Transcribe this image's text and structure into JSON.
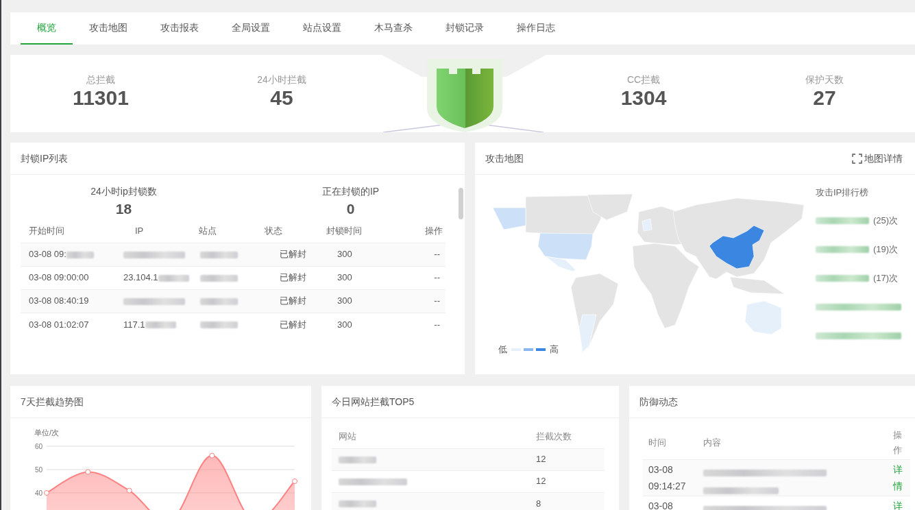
{
  "tabs": [
    {
      "label": "概览",
      "selected": true
    },
    {
      "label": "攻击地图",
      "selected": false
    },
    {
      "label": "攻击报表",
      "selected": false
    },
    {
      "label": "全局设置",
      "selected": false
    },
    {
      "label": "站点设置",
      "selected": false
    },
    {
      "label": "木马查杀",
      "selected": false
    },
    {
      "label": "封锁记录",
      "selected": false
    },
    {
      "label": "操作日志",
      "selected": false
    }
  ],
  "stats": [
    {
      "label": "总拦截",
      "value": "11301"
    },
    {
      "label": "24小时拦截",
      "value": "45"
    },
    {
      "label": "CC拦截",
      "value": "1304"
    },
    {
      "label": "保护天数",
      "value": "27"
    }
  ],
  "block_list": {
    "title": "封锁IP列表",
    "summary": [
      {
        "label": "24小时ip封锁数",
        "value": "18"
      },
      {
        "label": "正在封锁的IP",
        "value": "0"
      }
    ],
    "columns": [
      "开始时间",
      "IP",
      "站点",
      "状态",
      "封锁时间",
      "操作"
    ],
    "rows": [
      {
        "start_time": "03-08 09:",
        "time_blurred": true,
        "status": "已解封",
        "duration": "300",
        "action": "--"
      },
      {
        "start_time": "03-08 09:00:00",
        "time_blurred": false,
        "ip": "23.104.1",
        "status": "已解封",
        "duration": "300",
        "action": "--"
      },
      {
        "start_time": "03-08 08:40:19",
        "time_blurred": false,
        "status": "已解封",
        "duration": "300",
        "action": "--"
      },
      {
        "start_time": "03-08 01:02:07",
        "time_blurred": false,
        "ip": "117.1",
        "status": "已解封",
        "duration": "300",
        "action": "--"
      }
    ]
  },
  "attack_map": {
    "title": "攻击地图",
    "detail_link": "地图详情",
    "ranking_title": "攻击IP排行榜",
    "ranking": [
      {
        "kind": "count",
        "count": "(25)次"
      },
      {
        "kind": "count",
        "count": "(19)次"
      },
      {
        "kind": "count",
        "count": "(17)次"
      },
      {
        "kind": "blurred"
      },
      {
        "kind": "blurred"
      }
    ],
    "legend": {
      "low": "低",
      "high": "高"
    }
  },
  "trend": {
    "title": "7天拦截趋势图",
    "chart_data": {
      "type": "area",
      "ylabel": "单位/次",
      "ylim": [
        0,
        60
      ],
      "yticks": [
        40,
        50,
        60
      ],
      "series": [
        {
          "color": "#ff8080",
          "values": [
            40,
            49,
            41,
            28,
            56,
            28,
            45
          ]
        }
      ]
    }
  },
  "top5": {
    "title": "今日网站拦截TOP5",
    "columns": [
      "网站",
      "拦截次数"
    ],
    "rows": [
      {
        "count": "12"
      },
      {
        "count": "12"
      },
      {
        "count": "8"
      }
    ]
  },
  "defense": {
    "title": "防御动态",
    "columns": [
      "时间",
      "内容",
      "操作"
    ],
    "rows": [
      {
        "time": "03-08 09:14:27",
        "action": "详情"
      },
      {
        "time": "03-08",
        "action": "详"
      }
    ]
  }
}
